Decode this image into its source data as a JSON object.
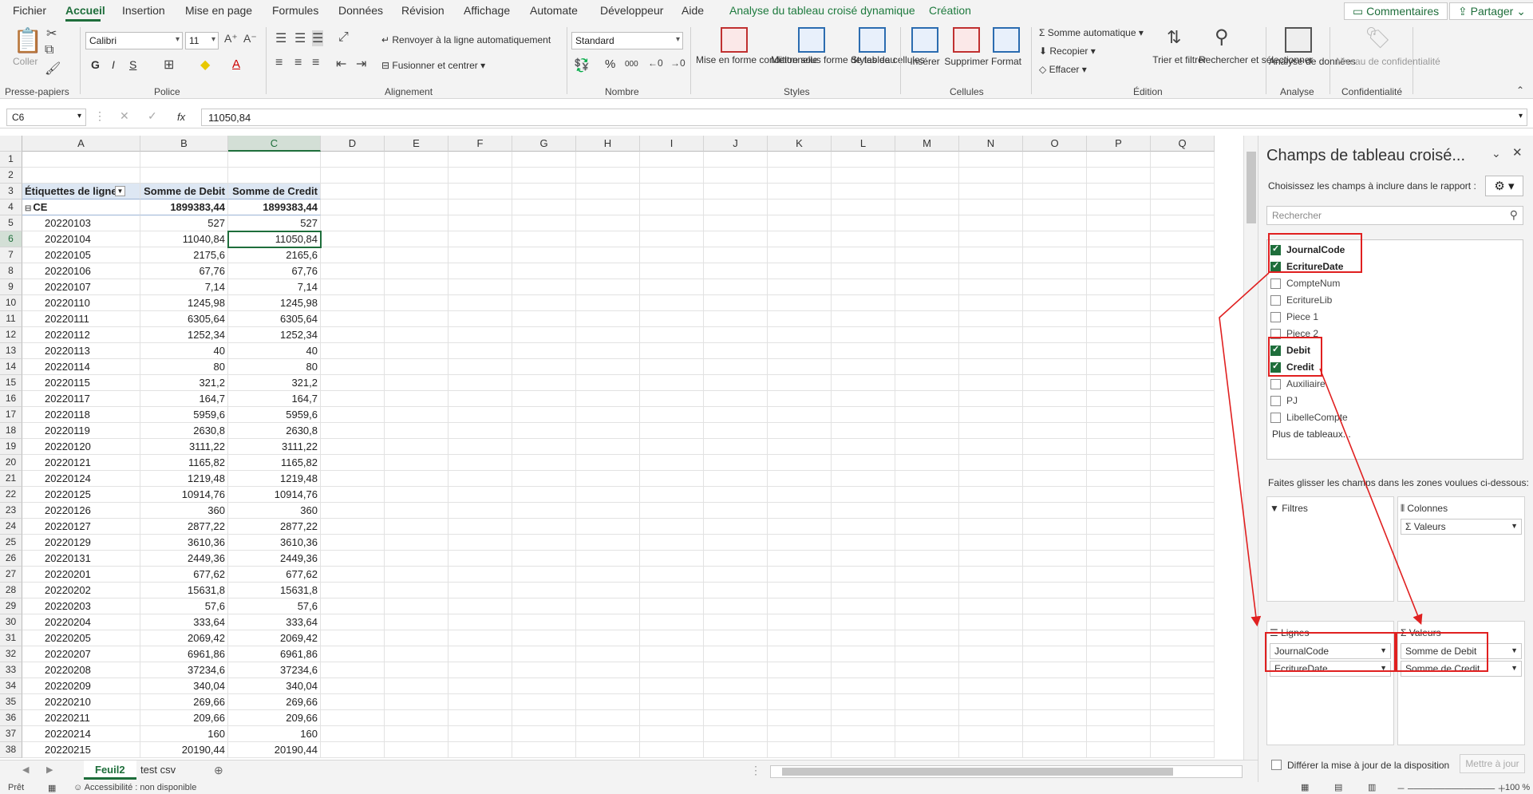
{
  "menu": {
    "tabs": [
      "Fichier",
      "Accueil",
      "Insertion",
      "Mise en page",
      "Formules",
      "Données",
      "Révision",
      "Affichage",
      "Automate",
      "Développeur",
      "Aide",
      "Analyse du tableau croisé dynamique",
      "Création"
    ],
    "comments": "Commentaires",
    "share": "Partager"
  },
  "ribbon": {
    "clipboard": {
      "paste": "Coller",
      "label": "Presse-papiers"
    },
    "font": {
      "name": "Calibri",
      "size": "11",
      "bold": "G",
      "italic": "I",
      "underline": "S",
      "color_letter": "A",
      "label": "Police"
    },
    "alignment": {
      "wrap": "Renvoyer à la ligne automatiquement",
      "merge": "Fusionner et centrer",
      "label": "Alignement"
    },
    "number": {
      "format": "Standard",
      "percent": "%",
      "thousands": "000",
      "label": "Nombre"
    },
    "styles": {
      "conditional": "Mise en forme conditionnelle",
      "as_table": "Mettre sous forme de tableau",
      "cell_styles": "Styles de cellules",
      "label": "Styles"
    },
    "cells": {
      "insert": "Insérer",
      "delete": "Supprimer",
      "format": "Format",
      "label": "Cellules"
    },
    "editing": {
      "autosum": "Somme automatique",
      "fill": "Recopier",
      "clear": "Effacer",
      "sort": "Trier et filtrer",
      "find": "Rechercher et sélectionner",
      "label": "Édition"
    },
    "analysis": {
      "analyze": "Analyse de données",
      "label": "Analyse"
    },
    "sensitivity": {
      "level": "Niveau de confidentialité",
      "label": "Confidentialité"
    }
  },
  "formula_bar": {
    "name_box": "C6",
    "fx": "fx",
    "value": "11050,84"
  },
  "grid": {
    "columns": [
      "A",
      "B",
      "C",
      "D",
      "E",
      "F",
      "G",
      "H",
      "I",
      "J",
      "K",
      "L",
      "M",
      "N",
      "O",
      "P",
      "Q"
    ],
    "selected_column": "C",
    "selected_row": 6,
    "header_row": [
      "Étiquettes de lignes",
      "Somme de Debit",
      "Somme de Credit"
    ],
    "group_row": {
      "label": "CE",
      "debit": "1899383,44",
      "credit": "1899383,44"
    },
    "rows": [
      [
        "20220103",
        "527",
        "527"
      ],
      [
        "20220104",
        "11040,84",
        "11050,84"
      ],
      [
        "20220105",
        "2175,6",
        "2165,6"
      ],
      [
        "20220106",
        "67,76",
        "67,76"
      ],
      [
        "20220107",
        "7,14",
        "7,14"
      ],
      [
        "20220110",
        "1245,98",
        "1245,98"
      ],
      [
        "20220111",
        "6305,64",
        "6305,64"
      ],
      [
        "20220112",
        "1252,34",
        "1252,34"
      ],
      [
        "20220113",
        "40",
        "40"
      ],
      [
        "20220114",
        "80",
        "80"
      ],
      [
        "20220115",
        "321,2",
        "321,2"
      ],
      [
        "20220117",
        "164,7",
        "164,7"
      ],
      [
        "20220118",
        "5959,6",
        "5959,6"
      ],
      [
        "20220119",
        "2630,8",
        "2630,8"
      ],
      [
        "20220120",
        "3111,22",
        "3111,22"
      ],
      [
        "20220121",
        "1165,82",
        "1165,82"
      ],
      [
        "20220124",
        "1219,48",
        "1219,48"
      ],
      [
        "20220125",
        "10914,76",
        "10914,76"
      ],
      [
        "20220126",
        "360",
        "360"
      ],
      [
        "20220127",
        "2877,22",
        "2877,22"
      ],
      [
        "20220129",
        "3610,36",
        "3610,36"
      ],
      [
        "20220131",
        "2449,36",
        "2449,36"
      ],
      [
        "20220201",
        "677,62",
        "677,62"
      ],
      [
        "20220202",
        "15631,8",
        "15631,8"
      ],
      [
        "20220203",
        "57,6",
        "57,6"
      ],
      [
        "20220204",
        "333,64",
        "333,64"
      ],
      [
        "20220205",
        "2069,42",
        "2069,42"
      ],
      [
        "20220207",
        "6961,86",
        "6961,86"
      ],
      [
        "20220208",
        "37234,6",
        "37234,6"
      ],
      [
        "20220209",
        "340,04",
        "340,04"
      ],
      [
        "20220210",
        "269,66",
        "269,66"
      ],
      [
        "20220211",
        "209,66",
        "209,66"
      ],
      [
        "20220214",
        "160",
        "160"
      ],
      [
        "20220215",
        "20190,44",
        "20190,44"
      ]
    ]
  },
  "sheets": {
    "tabs": [
      "Feuil2",
      "test csv"
    ],
    "active": "Feuil2"
  },
  "status": {
    "ready": "Prêt",
    "accessibility": "Accessibilité : non disponible",
    "zoom": "100 %"
  },
  "pivot_pane": {
    "title": "Champs de tableau croisé...",
    "subtitle": "Choisissez les champs à inclure dans le rapport :",
    "search_placeholder": "Rechercher",
    "fields": [
      {
        "name": "JournalCode",
        "checked": true
      },
      {
        "name": "EcritureDate",
        "checked": true
      },
      {
        "name": "CompteNum",
        "checked": false
      },
      {
        "name": "EcritureLib",
        "checked": false
      },
      {
        "name": "Piece 1",
        "checked": false
      },
      {
        "name": "Piece 2",
        "checked": false
      },
      {
        "name": "Debit",
        "checked": true
      },
      {
        "name": "Credit",
        "checked": true
      },
      {
        "name": "Auxiliaire",
        "checked": false
      },
      {
        "name": "PJ",
        "checked": false
      },
      {
        "name": "LibelleCompte",
        "checked": false
      }
    ],
    "more_tables": "Plus de tableaux...",
    "drag_hint": "Faites glisser les champs dans les zones voulues ci-dessous:",
    "zones": {
      "filters": "Filtres",
      "columns": "Colonnes",
      "rows": "Lignes",
      "values": "Valeurs",
      "columns_items": [
        "Valeurs"
      ],
      "rows_items": [
        "JournalCode",
        "EcritureDate"
      ],
      "values_items": [
        "Somme de Debit",
        "Somme de Credit"
      ]
    },
    "defer_update": "Différer la mise à jour de la disposition",
    "update_button": "Mettre à jour"
  },
  "colors": {
    "accent": "#1e6e3b",
    "highlight": "#e02020",
    "pivot_header": "#dde7f3"
  }
}
